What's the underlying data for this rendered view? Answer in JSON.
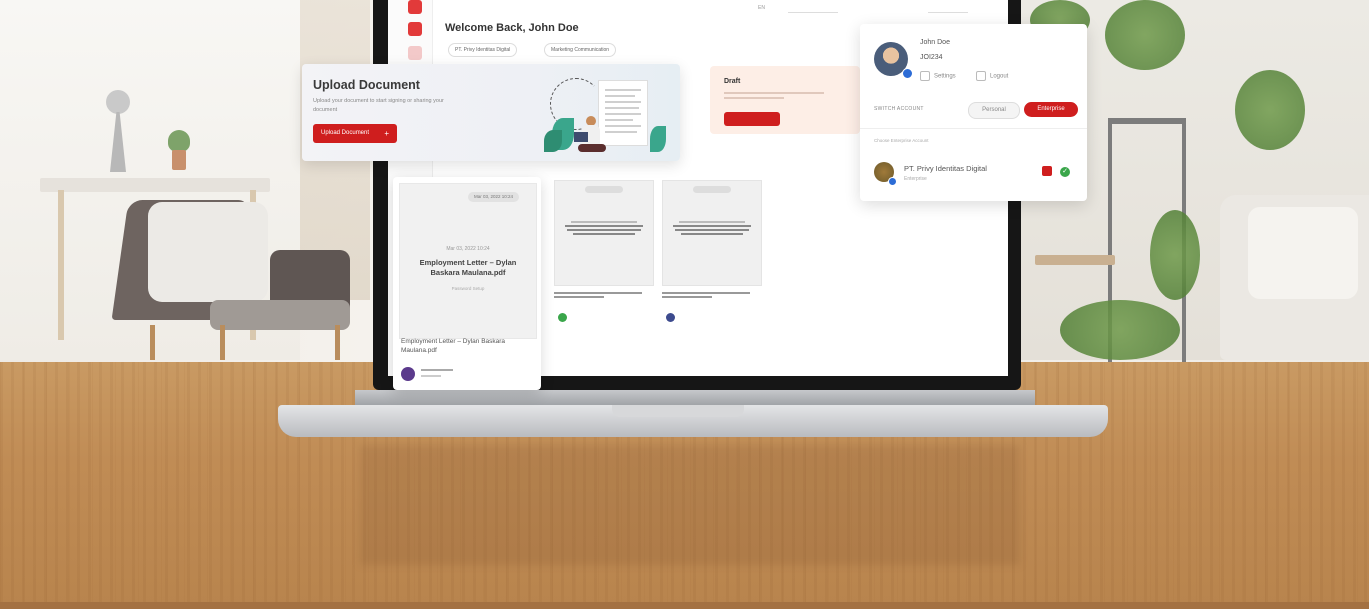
{
  "app": {
    "welcome": "Welcome Back, John Doe",
    "chips": [
      "PT. Privy Identitas Digital",
      "Marketing Communication"
    ]
  },
  "upload": {
    "title": "Upload Document",
    "description": "Upload your document to start signing or sharing your document",
    "button": "Upload Document",
    "button_icon": "+"
  },
  "draft": {
    "title": "Draft"
  },
  "big_doc": {
    "pill": "Mar 03, 2022 10:24",
    "date": "Mar 03, 2022 10:24",
    "name": "Employment Letter – Dylan Baskara Maulana.pdf",
    "password_note": "Password Setup",
    "file_name": "Employment Letter – Dylan Baskara Maulana.pdf"
  },
  "account": {
    "name": "John Doe",
    "id": "JOI234",
    "settings": "Settings",
    "logout": "Logout",
    "switch_label": "SWITCH ACCOUNT",
    "personal": "Personal",
    "enterprise": "Enterprise",
    "enterprise_label": "Choose Enterprise Account",
    "enterprise_name": "PT. Privy Identitas Digital",
    "enterprise_sub": "Enterprise"
  },
  "colors": {
    "accent": "#cf1e1e",
    "success": "#3aa64a",
    "badge": "#2c6cd6"
  }
}
